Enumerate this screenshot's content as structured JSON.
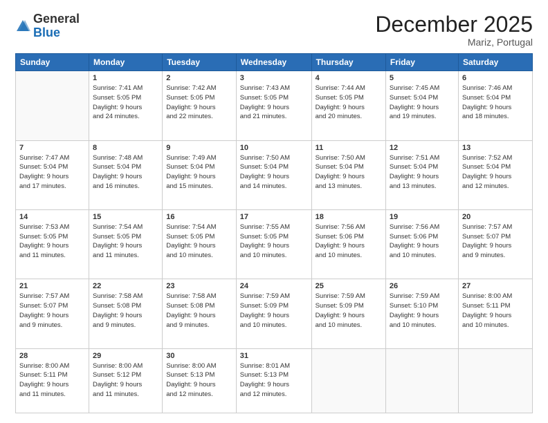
{
  "logo": {
    "general": "General",
    "blue": "Blue"
  },
  "header": {
    "month": "December 2025",
    "location": "Mariz, Portugal"
  },
  "weekdays": [
    "Sunday",
    "Monday",
    "Tuesday",
    "Wednesday",
    "Thursday",
    "Friday",
    "Saturday"
  ],
  "weeks": [
    [
      {
        "day": "",
        "info": ""
      },
      {
        "day": "1",
        "info": "Sunrise: 7:41 AM\nSunset: 5:05 PM\nDaylight: 9 hours\nand 24 minutes."
      },
      {
        "day": "2",
        "info": "Sunrise: 7:42 AM\nSunset: 5:05 PM\nDaylight: 9 hours\nand 22 minutes."
      },
      {
        "day": "3",
        "info": "Sunrise: 7:43 AM\nSunset: 5:05 PM\nDaylight: 9 hours\nand 21 minutes."
      },
      {
        "day": "4",
        "info": "Sunrise: 7:44 AM\nSunset: 5:05 PM\nDaylight: 9 hours\nand 20 minutes."
      },
      {
        "day": "5",
        "info": "Sunrise: 7:45 AM\nSunset: 5:04 PM\nDaylight: 9 hours\nand 19 minutes."
      },
      {
        "day": "6",
        "info": "Sunrise: 7:46 AM\nSunset: 5:04 PM\nDaylight: 9 hours\nand 18 minutes."
      }
    ],
    [
      {
        "day": "7",
        "info": "Sunrise: 7:47 AM\nSunset: 5:04 PM\nDaylight: 9 hours\nand 17 minutes."
      },
      {
        "day": "8",
        "info": "Sunrise: 7:48 AM\nSunset: 5:04 PM\nDaylight: 9 hours\nand 16 minutes."
      },
      {
        "day": "9",
        "info": "Sunrise: 7:49 AM\nSunset: 5:04 PM\nDaylight: 9 hours\nand 15 minutes."
      },
      {
        "day": "10",
        "info": "Sunrise: 7:50 AM\nSunset: 5:04 PM\nDaylight: 9 hours\nand 14 minutes."
      },
      {
        "day": "11",
        "info": "Sunrise: 7:50 AM\nSunset: 5:04 PM\nDaylight: 9 hours\nand 13 minutes."
      },
      {
        "day": "12",
        "info": "Sunrise: 7:51 AM\nSunset: 5:04 PM\nDaylight: 9 hours\nand 13 minutes."
      },
      {
        "day": "13",
        "info": "Sunrise: 7:52 AM\nSunset: 5:04 PM\nDaylight: 9 hours\nand 12 minutes."
      }
    ],
    [
      {
        "day": "14",
        "info": "Sunrise: 7:53 AM\nSunset: 5:05 PM\nDaylight: 9 hours\nand 11 minutes."
      },
      {
        "day": "15",
        "info": "Sunrise: 7:54 AM\nSunset: 5:05 PM\nDaylight: 9 hours\nand 11 minutes."
      },
      {
        "day": "16",
        "info": "Sunrise: 7:54 AM\nSunset: 5:05 PM\nDaylight: 9 hours\nand 10 minutes."
      },
      {
        "day": "17",
        "info": "Sunrise: 7:55 AM\nSunset: 5:05 PM\nDaylight: 9 hours\nand 10 minutes."
      },
      {
        "day": "18",
        "info": "Sunrise: 7:56 AM\nSunset: 5:06 PM\nDaylight: 9 hours\nand 10 minutes."
      },
      {
        "day": "19",
        "info": "Sunrise: 7:56 AM\nSunset: 5:06 PM\nDaylight: 9 hours\nand 10 minutes."
      },
      {
        "day": "20",
        "info": "Sunrise: 7:57 AM\nSunset: 5:07 PM\nDaylight: 9 hours\nand 9 minutes."
      }
    ],
    [
      {
        "day": "21",
        "info": "Sunrise: 7:57 AM\nSunset: 5:07 PM\nDaylight: 9 hours\nand 9 minutes."
      },
      {
        "day": "22",
        "info": "Sunrise: 7:58 AM\nSunset: 5:08 PM\nDaylight: 9 hours\nand 9 minutes."
      },
      {
        "day": "23",
        "info": "Sunrise: 7:58 AM\nSunset: 5:08 PM\nDaylight: 9 hours\nand 9 minutes."
      },
      {
        "day": "24",
        "info": "Sunrise: 7:59 AM\nSunset: 5:09 PM\nDaylight: 9 hours\nand 10 minutes."
      },
      {
        "day": "25",
        "info": "Sunrise: 7:59 AM\nSunset: 5:09 PM\nDaylight: 9 hours\nand 10 minutes."
      },
      {
        "day": "26",
        "info": "Sunrise: 7:59 AM\nSunset: 5:10 PM\nDaylight: 9 hours\nand 10 minutes."
      },
      {
        "day": "27",
        "info": "Sunrise: 8:00 AM\nSunset: 5:11 PM\nDaylight: 9 hours\nand 10 minutes."
      }
    ],
    [
      {
        "day": "28",
        "info": "Sunrise: 8:00 AM\nSunset: 5:11 PM\nDaylight: 9 hours\nand 11 minutes."
      },
      {
        "day": "29",
        "info": "Sunrise: 8:00 AM\nSunset: 5:12 PM\nDaylight: 9 hours\nand 11 minutes."
      },
      {
        "day": "30",
        "info": "Sunrise: 8:00 AM\nSunset: 5:13 PM\nDaylight: 9 hours\nand 12 minutes."
      },
      {
        "day": "31",
        "info": "Sunrise: 8:01 AM\nSunset: 5:13 PM\nDaylight: 9 hours\nand 12 minutes."
      },
      {
        "day": "",
        "info": ""
      },
      {
        "day": "",
        "info": ""
      },
      {
        "day": "",
        "info": ""
      }
    ]
  ]
}
